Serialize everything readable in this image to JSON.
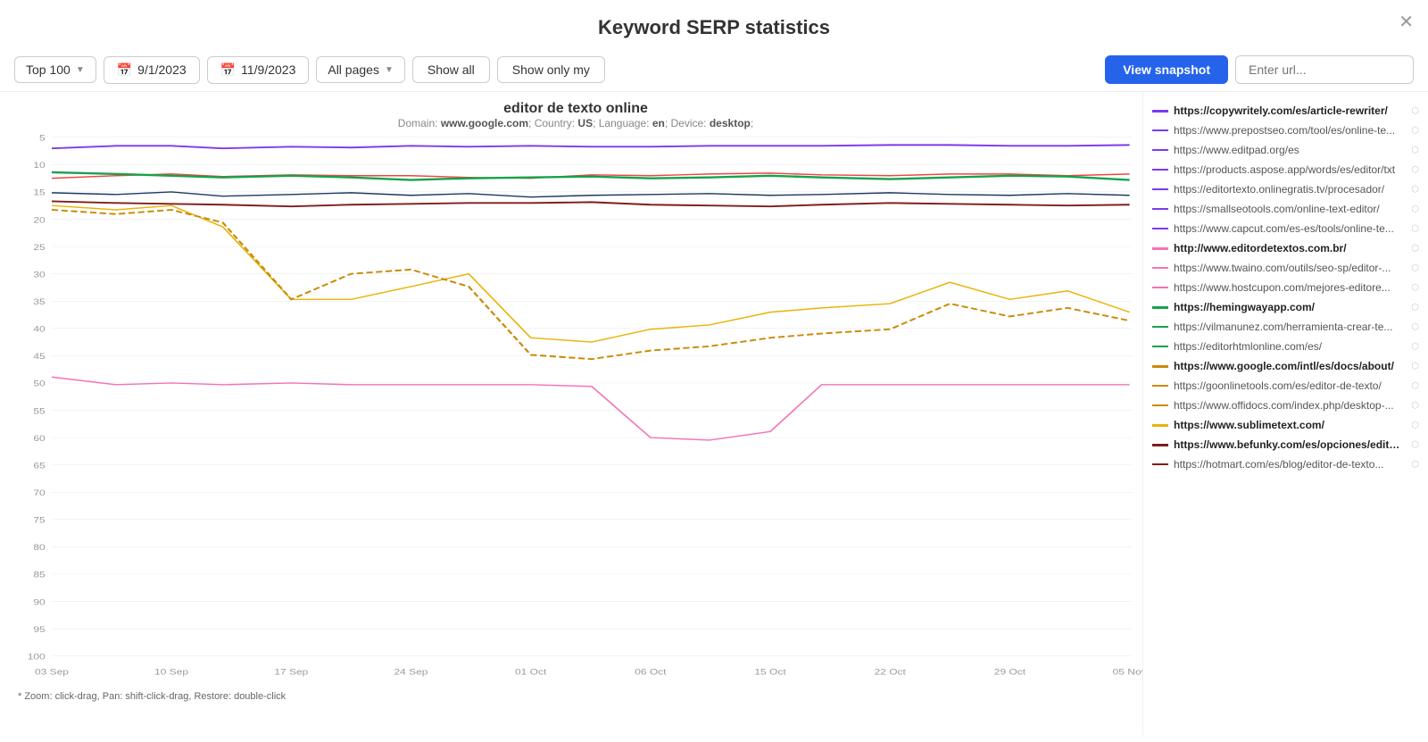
{
  "header": {
    "title": "Keyword SERP statistics",
    "close_label": "✕"
  },
  "toolbar": {
    "top100_label": "Top 100",
    "date_start": "9/1/2023",
    "date_end": "11/9/2023",
    "all_pages_label": "All pages",
    "show_all_label": "Show all",
    "show_only_my_label": "Show only my",
    "view_snapshot_label": "View snapshot",
    "url_search_placeholder": "Enter url..."
  },
  "chart": {
    "keyword": "editor de texto online",
    "meta_domain_label": "Domain:",
    "meta_domain": "www.google.com",
    "meta_country_label": "Country:",
    "meta_country": "US",
    "meta_language_label": "Language:",
    "meta_language": "en",
    "meta_device_label": "Device:",
    "meta_device": "desktop",
    "zoom_hint": "* Zoom: click-drag, Pan: shift-click-drag, Restore: double-click",
    "x_labels": [
      "03 Sep",
      "10 Sep",
      "17 Sep",
      "24 Sep",
      "01 Oct",
      "06 Oct",
      "15 Oct",
      "22 Oct",
      "29 Oct",
      "05 Nov"
    ],
    "y_labels": [
      "5",
      "10",
      "15",
      "20",
      "25",
      "30",
      "35",
      "40",
      "45",
      "50",
      "55",
      "60",
      "65",
      "70",
      "75",
      "80",
      "85",
      "90",
      "95",
      "100"
    ]
  },
  "legend": [
    {
      "url": "https://copywritely.com/es/article-rewriter/",
      "color": "#7c3aed",
      "bold": true
    },
    {
      "url": "https://www.prepostseo.com/tool/es/online-te...",
      "color": "#7c3aed",
      "bold": false
    },
    {
      "url": "https://www.editpad.org/es",
      "color": "#7c3aed",
      "bold": false
    },
    {
      "url": "https://products.aspose.app/words/es/editor/txt",
      "color": "#7c3aed",
      "bold": false
    },
    {
      "url": "https://editortexto.onlinegratis.tv/procesador/",
      "color": "#7c3aed",
      "bold": false
    },
    {
      "url": "https://smallseotools.com/online-text-editor/",
      "color": "#7c3aed",
      "bold": false
    },
    {
      "url": "https://www.capcut.com/es-es/tools/online-te...",
      "color": "#7c3aed",
      "bold": false
    },
    {
      "url": "http://www.editordetextos.com.br/",
      "color": "#f472b6",
      "bold": true
    },
    {
      "url": "https://www.twaino.com/outils/seo-sp/editor-...",
      "color": "#f472b6",
      "bold": false
    },
    {
      "url": "https://www.hostcupon.com/mejores-editore...",
      "color": "#f472b6",
      "bold": false
    },
    {
      "url": "https://hemingwayapp.com/",
      "color": "#16a34a",
      "bold": true
    },
    {
      "url": "https://vilmanunez.com/herramienta-crear-te...",
      "color": "#16a34a",
      "bold": false
    },
    {
      "url": "https://editorhtmlonline.com/es/",
      "color": "#16a34a",
      "bold": false
    },
    {
      "url": "https://www.google.com/intl/es/docs/about/",
      "color": "#ca8a04",
      "bold": true
    },
    {
      "url": "https://goonlinetools.com/es/editor-de-texto/",
      "color": "#ca8a04",
      "bold": false
    },
    {
      "url": "https://www.offidocs.com/index.php/desktop-...",
      "color": "#ca8a04",
      "bold": false
    },
    {
      "url": "https://www.sublimetext.com/",
      "color": "#eab308",
      "bold": true
    },
    {
      "url": "https://www.befunky.com/es/opciones/editor-...",
      "color": "#7f1d1d",
      "bold": true
    },
    {
      "url": "https://hotmart.com/es/blog/editor-de-texto...",
      "color": "#7f1d1d",
      "bold": false
    }
  ]
}
